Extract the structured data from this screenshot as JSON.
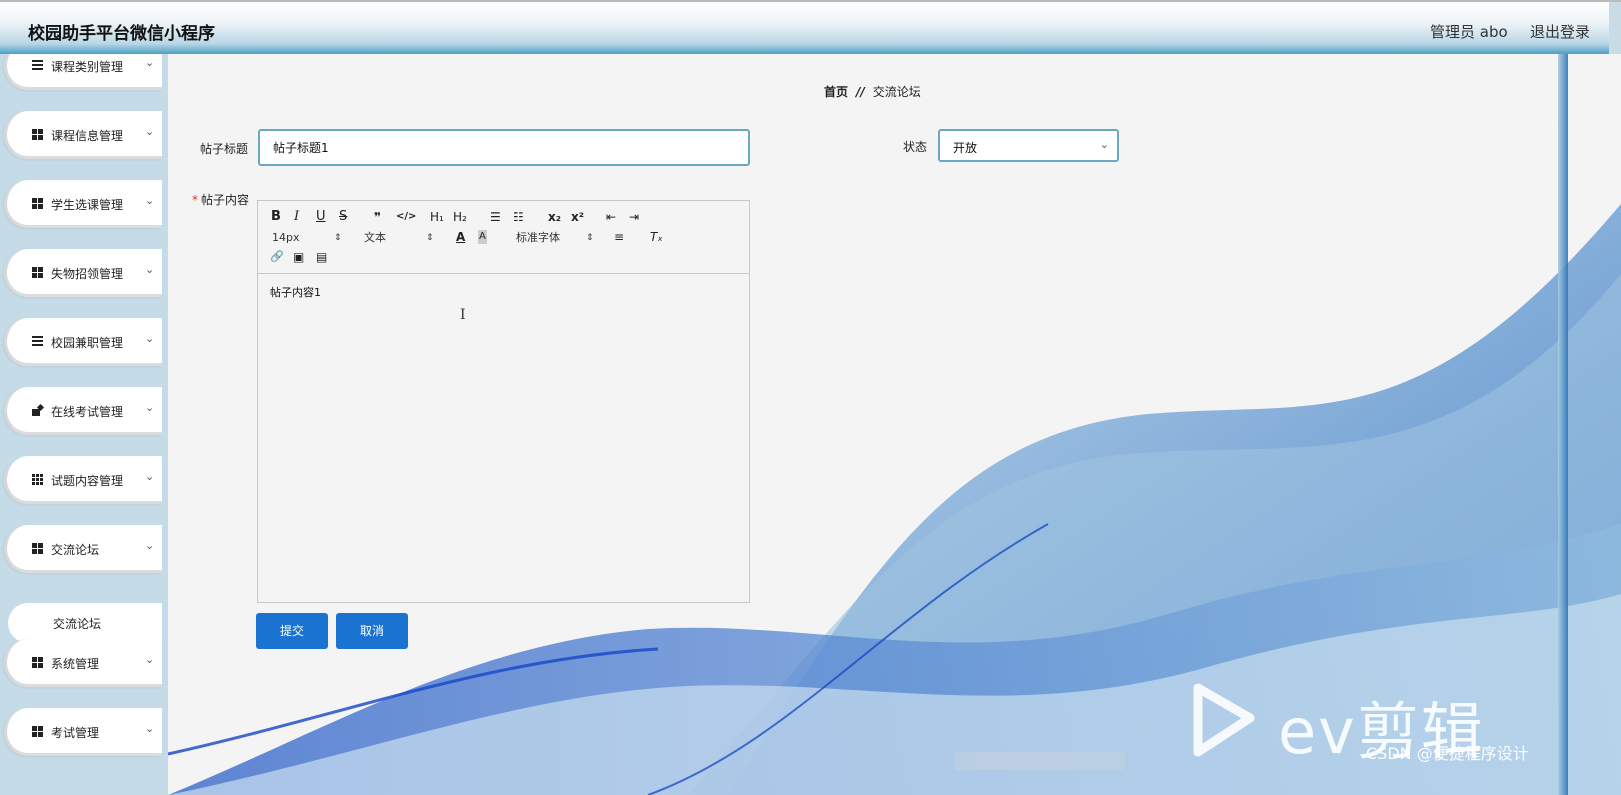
{
  "header": {
    "title": "校园助手平台微信小程序",
    "user": "管理员 abo",
    "logout": "退出登录"
  },
  "sidebar": {
    "items": [
      {
        "label": "课程类别管理",
        "icon": "list-icon"
      },
      {
        "label": "课程信息管理",
        "icon": "grid-icon"
      },
      {
        "label": "学生选课管理",
        "icon": "grid-icon"
      },
      {
        "label": "失物招领管理",
        "icon": "grid-icon"
      },
      {
        "label": "校园兼职管理",
        "icon": "list-icon"
      },
      {
        "label": "在线考试管理",
        "icon": "edit-icon"
      },
      {
        "label": "试题内容管理",
        "icon": "apps-icon"
      },
      {
        "label": "交流论坛",
        "icon": "grid-icon"
      },
      {
        "label": "系统管理",
        "icon": "grid-icon"
      },
      {
        "label": "考试管理",
        "icon": "grid-icon"
      }
    ],
    "sub_item": "交流论坛",
    "chevron": "⌄"
  },
  "breadcrumb": {
    "home": "首页",
    "separator": "//",
    "current": "交流论坛"
  },
  "form": {
    "title_label": "帖子标题",
    "title_value": "帖子标题1",
    "status_label": "状态",
    "status_value": "开放",
    "content_label": "帖子内容",
    "required_mark": "*",
    "content_value": "帖子内容1"
  },
  "editor_toolbar": {
    "bold": "B",
    "italic": "I",
    "underline": "U",
    "strike": "S",
    "quote": "❞",
    "code": "</>",
    "h1": "H₁",
    "h2": "H₂",
    "ordered_list": "☰",
    "bullet_list": "☷",
    "subscript": "x₂",
    "superscript": "x²",
    "outdent": "⇤",
    "indent": "⇥",
    "size_value": "14px",
    "format_value": "文本",
    "font_value": "标准字体",
    "color": "A",
    "background": "A",
    "align": "≡",
    "clean": "Tₓ",
    "link": "🔗",
    "image": "▣",
    "video": "▤",
    "picker_arrows": "⇕"
  },
  "buttons": {
    "submit": "提交",
    "cancel": "取消"
  },
  "watermark": {
    "ev_text": "ev剪辑",
    "csdn": "CSDN @便捷程序设计"
  },
  "colors": {
    "accent_button": "#1a73d0",
    "input_border": "#6aa7c2",
    "sidebar_bg": "#c5dbe7"
  }
}
